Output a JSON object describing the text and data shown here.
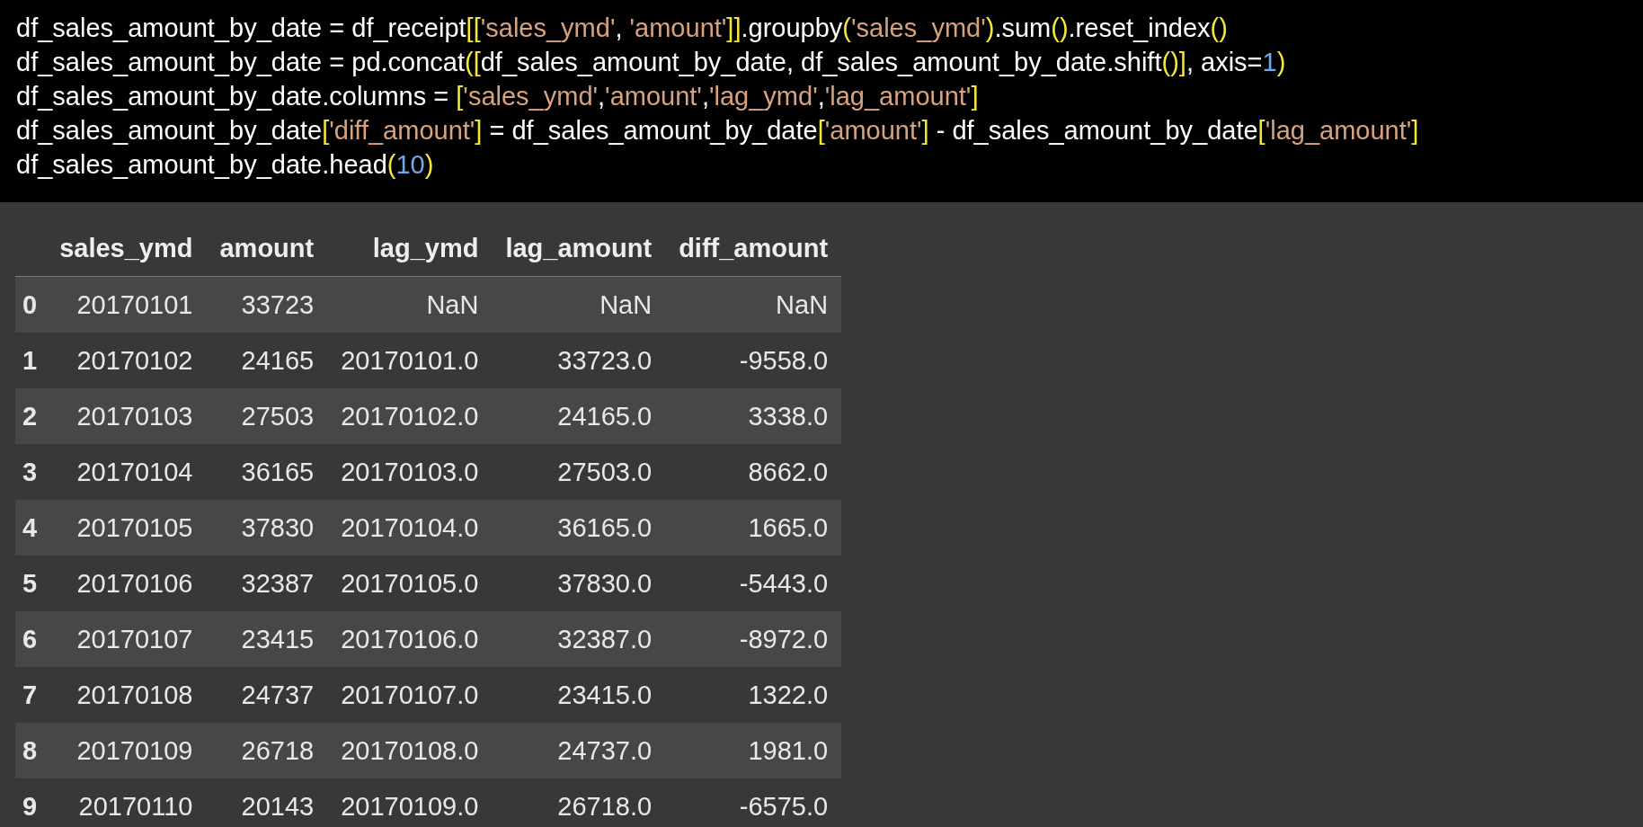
{
  "code_lines": [
    [
      {
        "kind": "plain",
        "text": "df_sales_amount_by_date = df_receipt"
      },
      {
        "kind": "bracket",
        "text": "[["
      },
      {
        "kind": "string",
        "text": "'sales_ymd'"
      },
      {
        "kind": "plain",
        "text": ", "
      },
      {
        "kind": "string",
        "text": "'amount'"
      },
      {
        "kind": "bracket",
        "text": "]]"
      },
      {
        "kind": "plain",
        "text": ".groupby"
      },
      {
        "kind": "bracket",
        "text": "("
      },
      {
        "kind": "string",
        "text": "'sales_ymd'"
      },
      {
        "kind": "bracket",
        "text": ")"
      },
      {
        "kind": "plain",
        "text": ".sum"
      },
      {
        "kind": "bracket",
        "text": "()"
      },
      {
        "kind": "plain",
        "text": ".reset_index"
      },
      {
        "kind": "bracket",
        "text": "()"
      }
    ],
    [
      {
        "kind": "plain",
        "text": "df_sales_amount_by_date = pd.concat"
      },
      {
        "kind": "bracket",
        "text": "(["
      },
      {
        "kind": "plain",
        "text": "df_sales_amount_by_date, df_sales_amount_by_date.shift"
      },
      {
        "kind": "bracket",
        "text": "()"
      },
      {
        "kind": "bracket",
        "text": "]"
      },
      {
        "kind": "plain",
        "text": ", axis="
      },
      {
        "kind": "number",
        "text": "1"
      },
      {
        "kind": "bracket",
        "text": ")"
      }
    ],
    [
      {
        "kind": "plain",
        "text": "df_sales_amount_by_date.columns = "
      },
      {
        "kind": "bracket",
        "text": "["
      },
      {
        "kind": "string",
        "text": "'sales_ymd'"
      },
      {
        "kind": "plain",
        "text": ","
      },
      {
        "kind": "string",
        "text": "'amount'"
      },
      {
        "kind": "plain",
        "text": ","
      },
      {
        "kind": "string",
        "text": "'lag_ymd'"
      },
      {
        "kind": "plain",
        "text": ","
      },
      {
        "kind": "string",
        "text": "'lag_amount'"
      },
      {
        "kind": "bracket",
        "text": "]"
      }
    ],
    [
      {
        "kind": "plain",
        "text": "df_sales_amount_by_date"
      },
      {
        "kind": "bracket",
        "text": "["
      },
      {
        "kind": "string",
        "text": "'diff_amount'"
      },
      {
        "kind": "bracket",
        "text": "]"
      },
      {
        "kind": "plain",
        "text": " = df_sales_amount_by_date"
      },
      {
        "kind": "bracket",
        "text": "["
      },
      {
        "kind": "string",
        "text": "'amount'"
      },
      {
        "kind": "bracket",
        "text": "]"
      },
      {
        "kind": "plain",
        "text": " - df_sales_amount_by_date"
      },
      {
        "kind": "bracket",
        "text": "["
      },
      {
        "kind": "string",
        "text": "'lag_amount'"
      },
      {
        "kind": "bracket",
        "text": "]"
      }
    ],
    [
      {
        "kind": "plain",
        "text": "df_sales_amount_by_date.head"
      },
      {
        "kind": "bracket",
        "text": "("
      },
      {
        "kind": "number",
        "text": "10"
      },
      {
        "kind": "bracket",
        "text": ")"
      }
    ]
  ],
  "table": {
    "columns": [
      "sales_ymd",
      "amount",
      "lag_ymd",
      "lag_amount",
      "diff_amount"
    ],
    "rows": [
      {
        "index": "0",
        "cells": [
          "20170101",
          "33723",
          "NaN",
          "NaN",
          "NaN"
        ]
      },
      {
        "index": "1",
        "cells": [
          "20170102",
          "24165",
          "20170101.0",
          "33723.0",
          "-9558.0"
        ]
      },
      {
        "index": "2",
        "cells": [
          "20170103",
          "27503",
          "20170102.0",
          "24165.0",
          "3338.0"
        ]
      },
      {
        "index": "3",
        "cells": [
          "20170104",
          "36165",
          "20170103.0",
          "27503.0",
          "8662.0"
        ]
      },
      {
        "index": "4",
        "cells": [
          "20170105",
          "37830",
          "20170104.0",
          "36165.0",
          "1665.0"
        ]
      },
      {
        "index": "5",
        "cells": [
          "20170106",
          "32387",
          "20170105.0",
          "37830.0",
          "-5443.0"
        ]
      },
      {
        "index": "6",
        "cells": [
          "20170107",
          "23415",
          "20170106.0",
          "32387.0",
          "-8972.0"
        ]
      },
      {
        "index": "7",
        "cells": [
          "20170108",
          "24737",
          "20170107.0",
          "23415.0",
          "1322.0"
        ]
      },
      {
        "index": "8",
        "cells": [
          "20170109",
          "26718",
          "20170108.0",
          "24737.0",
          "1981.0"
        ]
      },
      {
        "index": "9",
        "cells": [
          "20170110",
          "20143",
          "20170109.0",
          "26718.0",
          "-6575.0"
        ]
      }
    ]
  }
}
